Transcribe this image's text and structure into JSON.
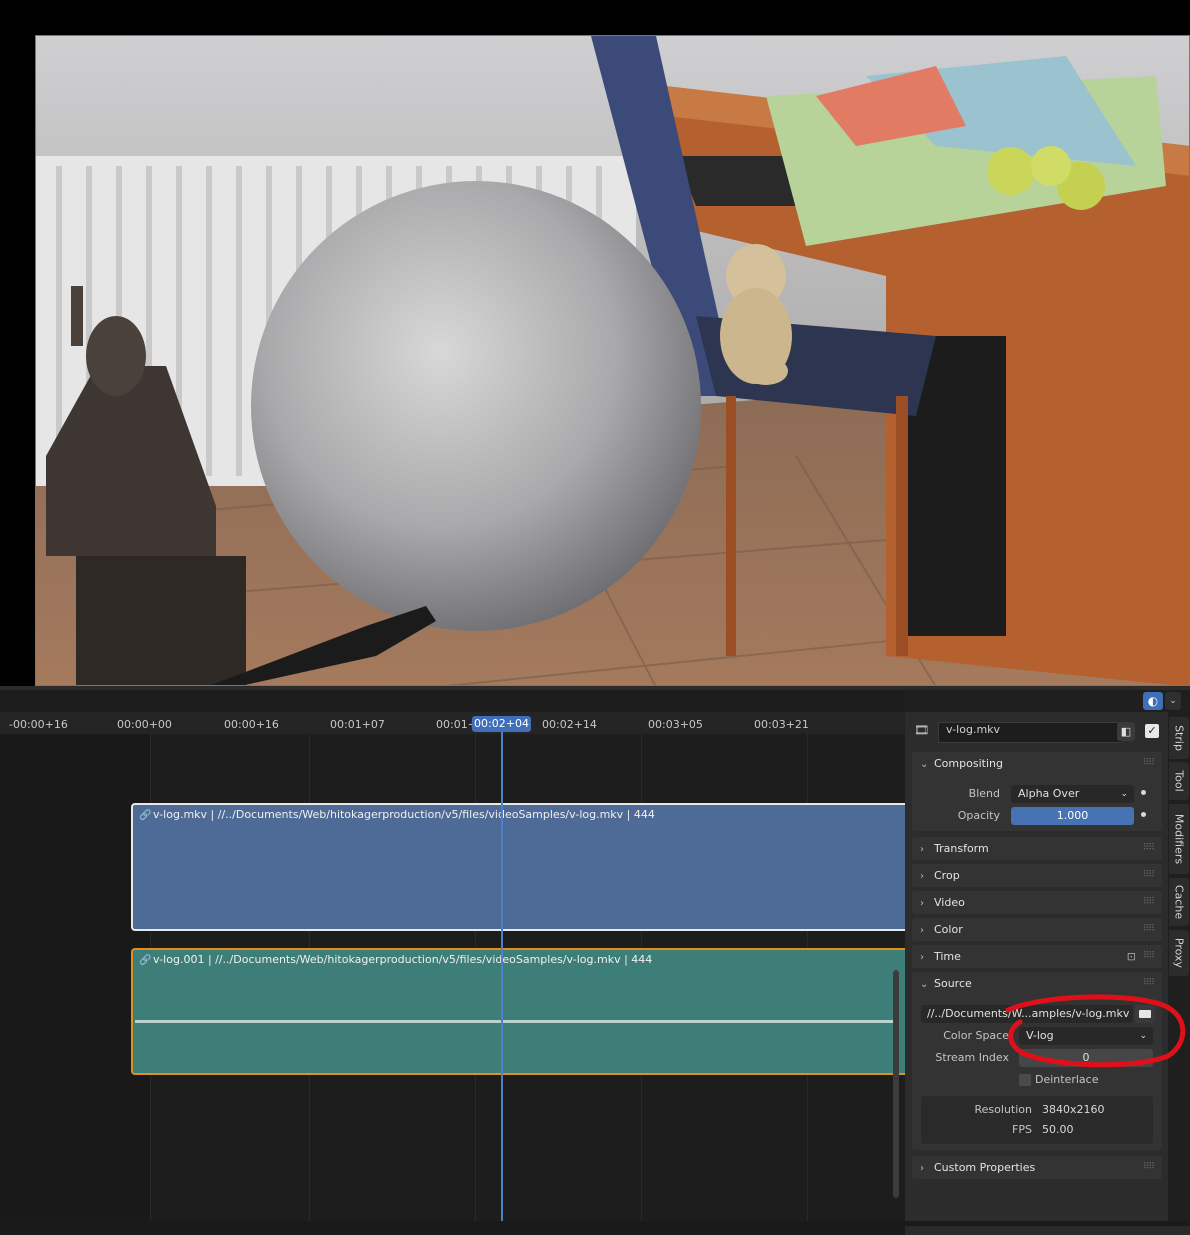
{
  "timeline": {
    "ticks": [
      "-00:00+16",
      "00:00+00",
      "00:00+16",
      "00:01+07",
      "00:01+",
      "00:02+14",
      "00:03+05",
      "00:03+21"
    ],
    "playhead": "00:02+04",
    "strips": [
      {
        "label": "v-log.mkv | //../Documents/Web/hitokagerproduction/v5/files/videoSamples/v-log.mkv | 444"
      },
      {
        "label": "v-log.001 | //../Documents/Web/hitokagerproduction/v5/files/videoSamples/v-log.mkv | 444"
      }
    ]
  },
  "sidebar": {
    "strip_name": "v-log.mkv",
    "tabs": [
      "Strip",
      "Tool",
      "Modifiers",
      "Cache",
      "Proxy"
    ],
    "panels": {
      "compositing": "Compositing",
      "blend_label": "Blend",
      "blend_value": "Alpha Over",
      "opacity_label": "Opacity",
      "opacity_value": "1.000",
      "transform": "Transform",
      "crop": "Crop",
      "video": "Video",
      "color": "Color",
      "time": "Time",
      "source": "Source",
      "filepath": "//../Documents/W...amples/v-log.mkv",
      "color_space_label": "Color Space",
      "color_space_value": "V-log",
      "stream_index_label": "Stream Index",
      "stream_index_value": "0",
      "deinterlace_label": "Deinterlace",
      "resolution_label": "Resolution",
      "resolution_value": "3840x2160",
      "fps_label": "FPS",
      "fps_value": "50.00",
      "custom_properties": "Custom Properties"
    }
  },
  "colors": {
    "accent": "#3f6fb9",
    "movie_strip": "#4e6b97",
    "sound_strip": "#3e7e78",
    "selected_outline": "#e0901e",
    "annotation": "#e0101a"
  }
}
